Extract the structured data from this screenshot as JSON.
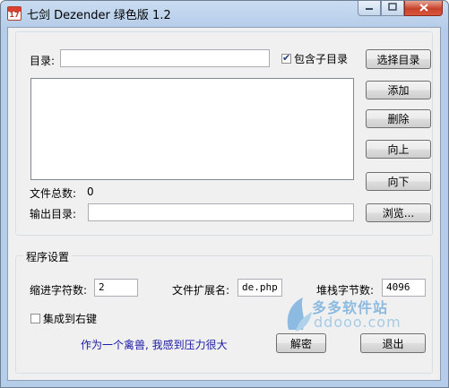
{
  "window": {
    "title": "七剑 Dezender 绿色版 1.2",
    "icon_number": "17",
    "minimize_icon": "minimize-icon",
    "maximize_icon": "maximize-icon",
    "close_icon": "close-icon"
  },
  "directory": {
    "label": "目录:",
    "value": "",
    "include_subdirs_label": "包含子目录",
    "include_subdirs_checked": true,
    "select_button": "选择目录"
  },
  "file_list": {
    "items": [],
    "add_button": "添加",
    "delete_button": "删除",
    "up_button": "向上",
    "down_button": "向下"
  },
  "total": {
    "label": "文件总数:",
    "value": "0"
  },
  "output": {
    "label": "输出目录:",
    "value": "",
    "browse_button": "浏览..."
  },
  "settings": {
    "title": "程序设置",
    "indent_label": "缩进字符数:",
    "indent_value": "2",
    "ext_label": "文件扩展名:",
    "ext_value": "de.php",
    "stack_label": "堆栈字节数:",
    "stack_value": "4096",
    "integrate_label": "集成到右键",
    "integrate_checked": false
  },
  "motto": "作为一个禽兽, 我感到压力很大",
  "actions": {
    "decrypt_button": "解密",
    "exit_button": "退出"
  },
  "watermark": {
    "text": "多多软件站",
    "url": "ddooo.com"
  },
  "colors": {
    "motto": "#1a1aa6",
    "title_bar": "#b6cde9",
    "close_button": "#c7432b"
  }
}
